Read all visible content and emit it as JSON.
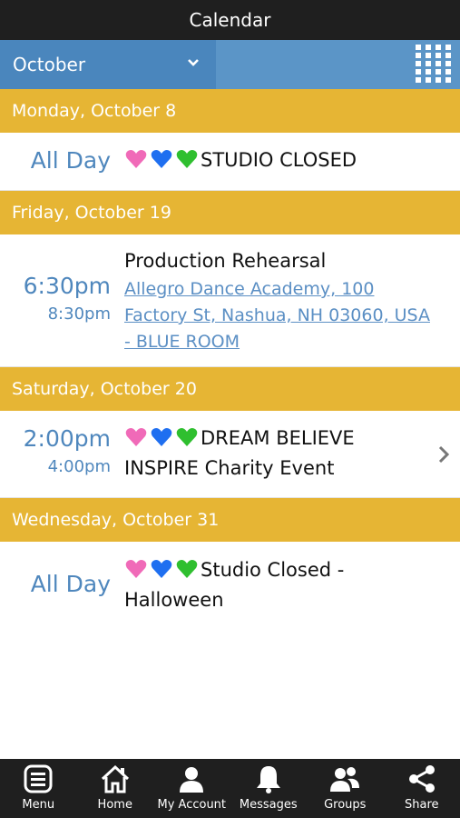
{
  "header": {
    "title": "Calendar"
  },
  "month_selector": {
    "value": "October",
    "icon": "chevron-down-icon"
  },
  "grid_button": {
    "icon": "grid-icon"
  },
  "days": [
    {
      "header": "Monday, October 8",
      "events": [
        {
          "all_day": "All Day",
          "title": "STUDIO CLOSED",
          "hearts": true
        }
      ]
    },
    {
      "header": "Friday, October 19",
      "events": [
        {
          "start": "6:30pm",
          "end": "8:30pm",
          "title": "Production Rehearsal",
          "location": "Allegro Dance Academy, 100 Factory St, Nashua, NH 03060, USA - BLUE ROOM"
        }
      ]
    },
    {
      "header": "Saturday, October 20",
      "events": [
        {
          "start": "2:00pm",
          "end": "4:00pm",
          "title": "DREAM BELIEVE INSPIRE Charity Event",
          "hearts": true
        }
      ]
    },
    {
      "header": "Wednesday, October 31",
      "events": [
        {
          "all_day": "All Day",
          "title": "Studio Closed - Halloween",
          "hearts": true
        }
      ]
    }
  ],
  "heart_colors": [
    "#f06ab8",
    "#1f6ff0",
    "#2fbf2f"
  ],
  "tabs": [
    {
      "label": "Menu",
      "icon": "menu-icon"
    },
    {
      "label": "Home",
      "icon": "home-icon"
    },
    {
      "label": "My Account",
      "icon": "user-icon"
    },
    {
      "label": "Messages",
      "icon": "bell-icon"
    },
    {
      "label": "Groups",
      "icon": "group-icon"
    },
    {
      "label": "Share",
      "icon": "share-icon"
    }
  ]
}
